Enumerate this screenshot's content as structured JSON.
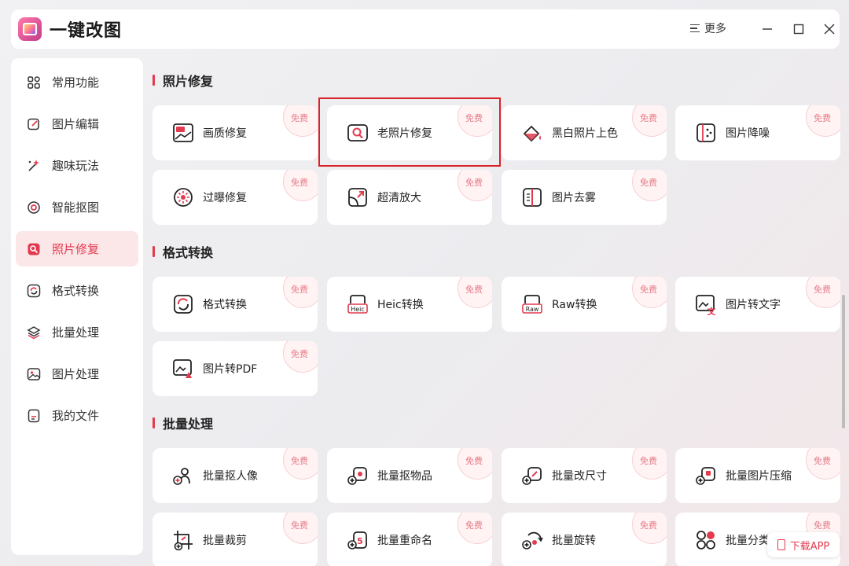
{
  "app": {
    "title": "一键改图"
  },
  "titlebar": {
    "more_label": "更多"
  },
  "sidebar": {
    "items": [
      {
        "label": "常用功能",
        "icon": "grid-icon",
        "active": false
      },
      {
        "label": "图片编辑",
        "icon": "edit-icon",
        "active": false
      },
      {
        "label": "趣味玩法",
        "icon": "magic-wand-icon",
        "active": false
      },
      {
        "label": "智能抠图",
        "icon": "target-icon",
        "active": false
      },
      {
        "label": "照片修复",
        "icon": "photo-repair-icon",
        "active": true
      },
      {
        "label": "格式转换",
        "icon": "convert-icon",
        "active": false
      },
      {
        "label": "批量处理",
        "icon": "layers-icon",
        "active": false
      },
      {
        "label": "图片处理",
        "icon": "image-icon",
        "active": false
      },
      {
        "label": "我的文件",
        "icon": "file-icon",
        "active": false
      }
    ]
  },
  "sections": [
    {
      "title": "照片修复"
    },
    {
      "title": "格式转换"
    },
    {
      "title": "批量处理"
    }
  ],
  "badge_label": "免费",
  "cards": {
    "hd_repair": "画质修复",
    "old_photo": "老照片修复",
    "colorize": "黑白照片上色",
    "denoise": "图片降噪",
    "overexpose": "过曝修复",
    "upscale": "超清放大",
    "dehaze": "图片去雾",
    "format": "格式转换",
    "heic": "Heic转换",
    "raw": "Raw转换",
    "ocr": "图片转文字",
    "pdf": "图片转PDF",
    "batch_portrait": "批量抠人像",
    "batch_object": "批量抠物品",
    "batch_resize": "批量改尺寸",
    "batch_compress": "批量图片压缩",
    "batch_crop": "批量裁剪",
    "batch_rename": "批量重命名",
    "batch_rotate": "批量旋转",
    "batch_classify": "批量分类"
  },
  "icon_text": {
    "hd": "HD",
    "heic": "Heic",
    "raw": "Raw"
  },
  "download": {
    "label": "下载APP"
  },
  "colors": {
    "accent": "#e23a4e",
    "highlight_box": "#d9222a",
    "active_bg": "#fbe6e8"
  }
}
